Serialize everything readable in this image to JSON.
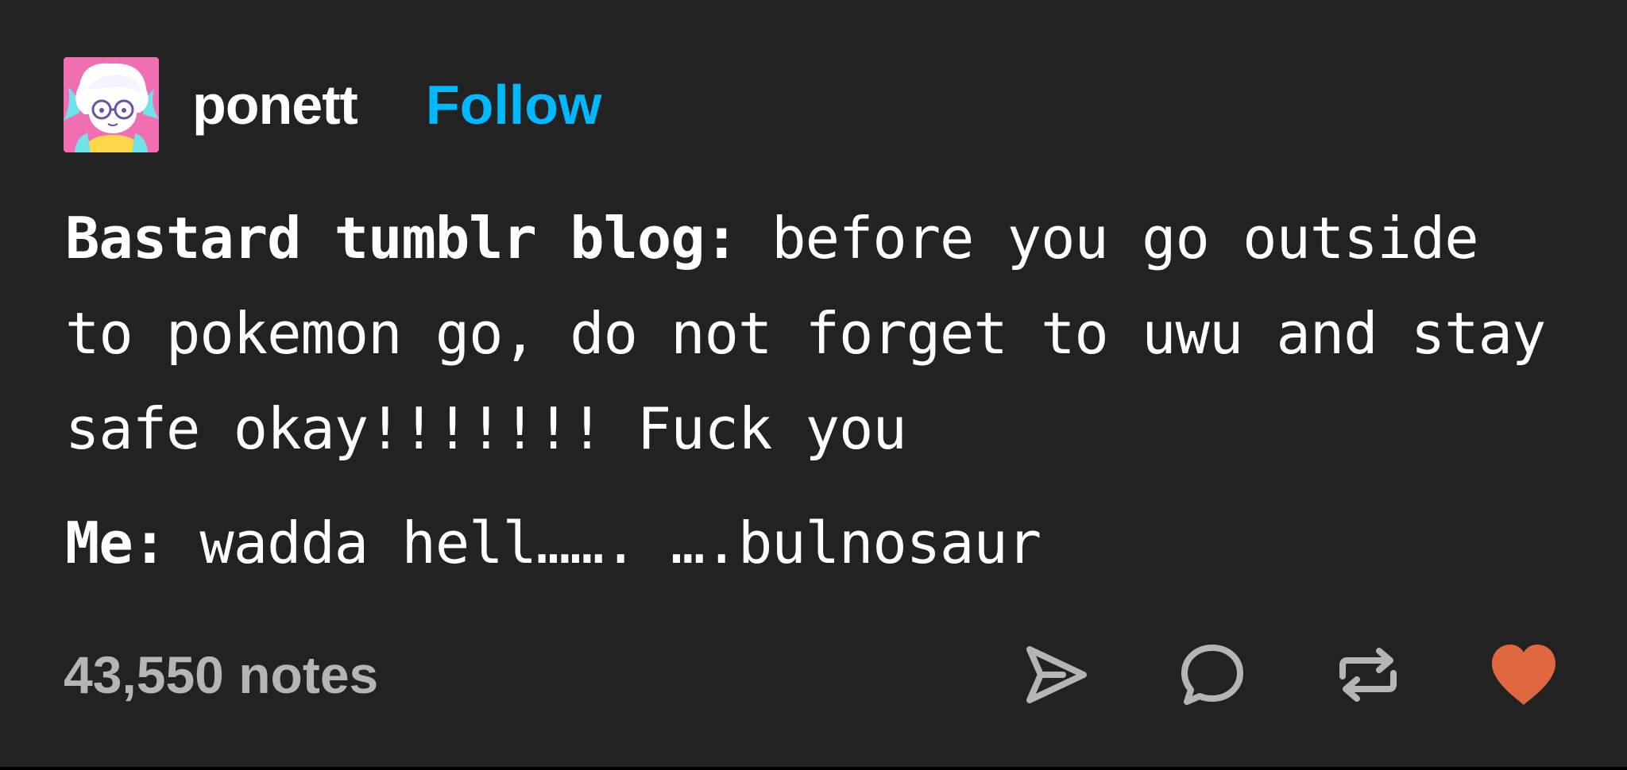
{
  "post": {
    "username": "ponett",
    "follow_label": "Follow",
    "paragraphs": [
      {
        "speaker": "Bastard tumblr blog:",
        "text": " before you go outside to pokemon go, do not forget to uwu and stay safe okay!!!!!!! Fuck you"
      },
      {
        "speaker": "Me:",
        "text": " wadda hell……. ….bulnosaur"
      }
    ]
  },
  "footer": {
    "notes": "43,550 notes",
    "icons": [
      "send-icon",
      "comment-icon",
      "reblog-icon",
      "heart-icon"
    ]
  },
  "colors": {
    "background": "#222222",
    "follow": "#00b8ff",
    "notes_text": "#b5b5b5",
    "icon": "#b5b5b5",
    "heart": "#e0683f",
    "avatar_bg": "#f06fb3"
  }
}
